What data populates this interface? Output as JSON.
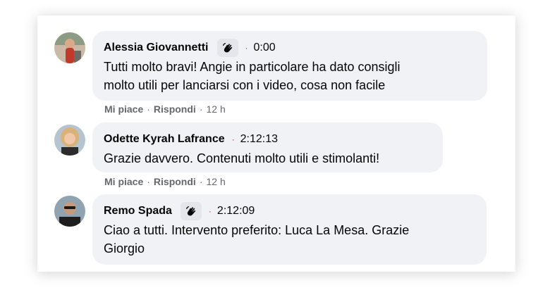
{
  "comments": [
    {
      "author": "Alessia Giovannetti",
      "has_badge": true,
      "time": "0:00",
      "text_lines": [
        "Tutti molto bravi! Angie in particolare ha dato consigli",
        "molto utili per lanciarsi con i video, cosa non facile"
      ],
      "like": "Mi piace",
      "reply": "Rispondi",
      "age": "12 h"
    },
    {
      "author": "Odette Kyrah Lafrance",
      "has_badge": false,
      "time": "2:12:13",
      "text_lines": [
        "Grazie davvero. Contenuti molto utili e stimolanti!"
      ],
      "like": "Mi piace",
      "reply": "Rispondi",
      "age": "12 h"
    },
    {
      "author": "Remo Spada",
      "has_badge": true,
      "time": "2:12:09",
      "text_lines": [
        "Ciao a tutti. Intervento preferito: Luca La Mesa. Grazie",
        "Giorgio"
      ]
    }
  ],
  "icons": {
    "badge": "sign-language-hand-icon",
    "separator": "dot-separator"
  },
  "colors": {
    "bubble": "#f0f2f5",
    "badge_bg": "#e4e6eb",
    "separator": "#e0245e",
    "meta_text": "#65676b"
  }
}
